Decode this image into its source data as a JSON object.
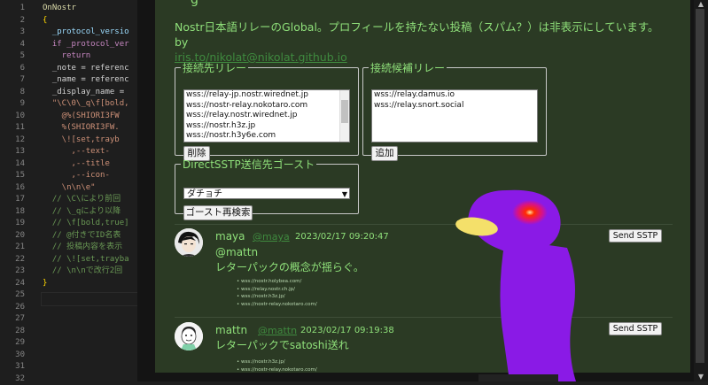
{
  "editor": {
    "lines": [
      {
        "n": "1",
        "text": "OnNostr",
        "cls": "c-fn"
      },
      {
        "n": "2",
        "text": "{",
        "cls": "c-br"
      },
      {
        "n": "3",
        "text": "  _protocol_versio",
        "cls": "c-var"
      },
      {
        "n": "4",
        "text": "  if _protocol_ver",
        "cls": "c-kw"
      },
      {
        "n": "5",
        "text": "    return",
        "cls": "c-kw"
      },
      {
        "n": "6",
        "text": "  _note = referenc",
        "cls": ""
      },
      {
        "n": "7",
        "text": "  _name = referenc",
        "cls": ""
      },
      {
        "n": "8",
        "text": "  _display_name =",
        "cls": ""
      },
      {
        "n": "9",
        "text": "  \"\\C\\0\\_q\\f[bold,",
        "cls": "c-str"
      },
      {
        "n": "10",
        "text": "    @%(SHIORI3FW",
        "cls": "c-str"
      },
      {
        "n": "11",
        "text": "    %(SHIORI3FW.",
        "cls": "c-str"
      },
      {
        "n": "12",
        "text": "    \\![set,trayb",
        "cls": "c-str"
      },
      {
        "n": "13",
        "text": "      ,--text-",
        "cls": "c-str"
      },
      {
        "n": "14",
        "text": "      ,--title",
        "cls": "c-str"
      },
      {
        "n": "15",
        "text": "      ,--icon-",
        "cls": "c-str"
      },
      {
        "n": "16",
        "text": "    \\n\\n\\e\"",
        "cls": "c-str"
      },
      {
        "n": "17",
        "text": "  // \\C\\により前回",
        "cls": "c-cm"
      },
      {
        "n": "18",
        "text": "  // \\_qにより以降",
        "cls": "c-cm"
      },
      {
        "n": "19",
        "text": "  // \\f[bold,true]",
        "cls": "c-cm"
      },
      {
        "n": "20",
        "text": "  // @付きでID名表",
        "cls": "c-cm"
      },
      {
        "n": "21",
        "text": "  // 投稿内容を表示",
        "cls": "c-cm"
      },
      {
        "n": "22",
        "text": "  // \\![set,trayba",
        "cls": "c-cm"
      },
      {
        "n": "23",
        "text": "  // \\n\\nで改行2回",
        "cls": "c-cm"
      },
      {
        "n": "24",
        "text": "}",
        "cls": "c-br"
      },
      {
        "n": "25",
        "text": "",
        "cls": ""
      },
      {
        "n": "26",
        "text": "",
        "cls": ""
      },
      {
        "n": "27",
        "text": "",
        "cls": ""
      },
      {
        "n": "28",
        "text": "",
        "cls": ""
      },
      {
        "n": "29",
        "text": "",
        "cls": ""
      },
      {
        "n": "30",
        "text": "",
        "cls": ""
      },
      {
        "n": "31",
        "text": "",
        "cls": ""
      },
      {
        "n": "32",
        "text": "",
        "cls": ""
      }
    ]
  },
  "header": {
    "description": "Nostr日本語リレーのGlobal。プロフィールを持たない投稿（スパム？）は非表示にしています。 by",
    "link": "iris.to/nikolat@nikolat.github.io"
  },
  "connect": {
    "legend": "接続先リレー",
    "relays": [
      "wss://relay-jp.nostr.wirednet.jp",
      "wss://nostr-relay.nokotaro.com",
      "wss://relay.nostr.wirednet.jp",
      "wss://nostr.h3z.jp",
      "wss://nostr.h3y6e.com"
    ],
    "delete_label": "削除"
  },
  "candidates": {
    "legend": "接続候補リレー",
    "relays": [
      "wss://relay.damus.io",
      "wss://relay.snort.social"
    ],
    "add_label": "追加"
  },
  "ghost": {
    "legend": "DirectSSTP送信先ゴースト",
    "selected": "ダチョチ",
    "rescan_label": "ゴースト再検索"
  },
  "posts": [
    {
      "name": "maya",
      "handle": "@maya",
      "time": "2023/02/17 09:20:47",
      "mention": "@mattn",
      "text": "レターパックの概念が揺らぐ。",
      "relays": [
        "wss://nostr.holybea.com/",
        "wss://relay.nostr.ch.jp/",
        "wss://nostr.h3z.jp/",
        "wss://nostr-relay.nokotaro.com/"
      ],
      "sstp_label": "Send SSTP"
    },
    {
      "name": "mattn",
      "handle": "@mattn",
      "time": "2023/02/17 09:19:38",
      "mention": "",
      "text": "レターパックでsatoshi送れ",
      "relays": [
        "wss://nostr.h3z.jp/",
        "wss://nostr-relay.nokotaro.com/"
      ],
      "sstp_label": "Send SSTP"
    }
  ],
  "colors": {
    "panel": "#2b3a24",
    "text": "#8fe07a",
    "bird_body": "#8a1ae6",
    "bird_beak": "#f4e06a",
    "bird_eye": "#ff2a00"
  }
}
